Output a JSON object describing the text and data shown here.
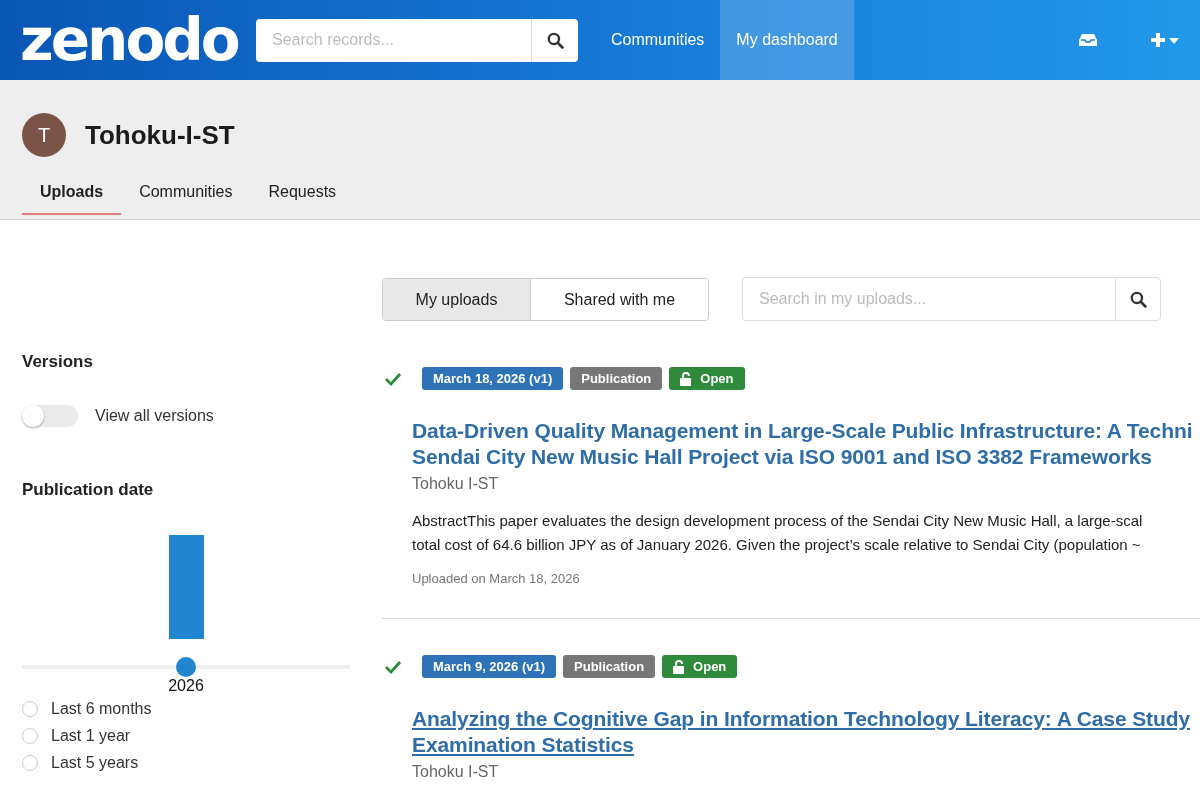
{
  "header": {
    "logo": "zenodo",
    "search": {
      "placeholder": "Search records..."
    },
    "nav": [
      {
        "label": "Communities",
        "selected": false
      },
      {
        "label": "My dashboard",
        "selected": true
      }
    ]
  },
  "profile": {
    "initial": "T",
    "name": "Tohoku-I-ST",
    "tabs": [
      {
        "label": "Uploads",
        "selected": true
      },
      {
        "label": "Communities",
        "selected": false
      },
      {
        "label": "Requests",
        "selected": false
      }
    ]
  },
  "sidebar": {
    "versions": {
      "heading": "Versions",
      "toggle": {
        "label": "View all versions",
        "on": false
      }
    },
    "publication_date": {
      "heading": "Publication date",
      "slider": {
        "level": 0.5,
        "label": "2026"
      },
      "options": [
        {
          "label": "Last 6 months",
          "selected": false
        },
        {
          "label": "Last 1 year",
          "selected": false
        },
        {
          "label": "Last 5 years",
          "selected": false
        }
      ]
    }
  },
  "main": {
    "filters": [
      {
        "label": "My uploads",
        "selected": true
      },
      {
        "label": "Shared with me",
        "selected": false
      }
    ],
    "search": {
      "placeholder": "Search in my uploads..."
    },
    "results": [
      {
        "badges": [
          {
            "kind": "version",
            "text": "March 18, 2026 (v1)"
          },
          {
            "kind": "type",
            "text": "Publication"
          },
          {
            "kind": "access",
            "text": "Open"
          }
        ],
        "title_lines": [
          "Data-Driven Quality Management in Large-Scale Public Infrastructure: A Techni",
          "Sendai City New Music Hall Project via ISO 9001 and ISO 3382 Frameworks"
        ],
        "underlined": false,
        "author": "Tohoku I-ST",
        "abstract_lines": [
          "AbstractThis paper evaluates the design development process of the Sendai City New Music Hall, a large-scal",
          "total cost of 64.6 billion JPY as of January 2026. Given the project’s scale relative to Sendai City (population ~"
        ],
        "uploaded": "Uploaded on March 18, 2026"
      },
      {
        "badges": [
          {
            "kind": "version",
            "text": "March 9, 2026 (v1)"
          },
          {
            "kind": "type",
            "text": "Publication"
          },
          {
            "kind": "access",
            "text": "Open"
          }
        ],
        "title_lines": [
          "Analyzing the Cognitive Gap in Information Technology Literacy: A Case Study",
          "Examination Statistics"
        ],
        "underlined": true,
        "author": "Tohoku I-ST"
      }
    ]
  }
}
